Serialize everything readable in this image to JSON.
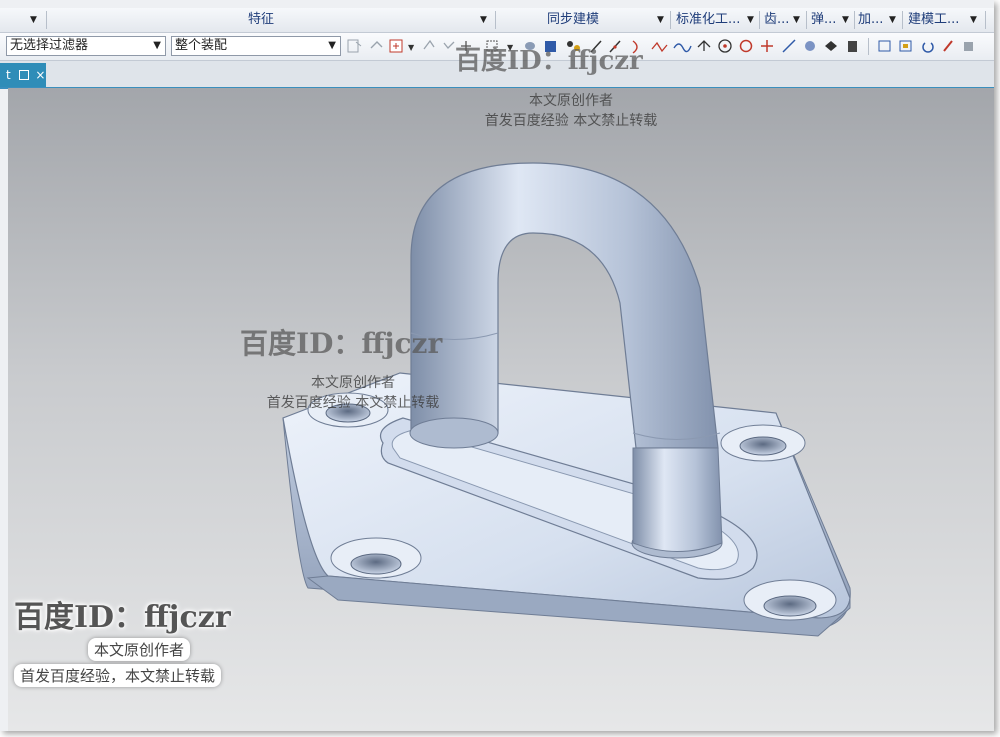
{
  "menubar": {
    "groups": [
      {
        "label": "特征"
      },
      {
        "label": "同步建模"
      },
      {
        "label": "标准化工..."
      },
      {
        "label": "齿..."
      },
      {
        "label": "弹..."
      },
      {
        "label": "加..."
      },
      {
        "label": "建模工..."
      }
    ]
  },
  "filterbar": {
    "selection_filter": "无选择过滤器",
    "scope": "整个装配"
  },
  "tabs": [
    {
      "label": "t",
      "icon": "part-icon",
      "close": "×"
    }
  ],
  "watermark": {
    "id": "百度ID：ffjczr",
    "line1": "本文原创作者",
    "line2": "首发百度经验  本文禁止转载",
    "line2_big": "首发百度经验，本文禁止转载"
  },
  "colors": {
    "tab_active": "#2f8db8",
    "part_shade": "#c7d3e6",
    "menu_text": "#1f3d7a"
  }
}
